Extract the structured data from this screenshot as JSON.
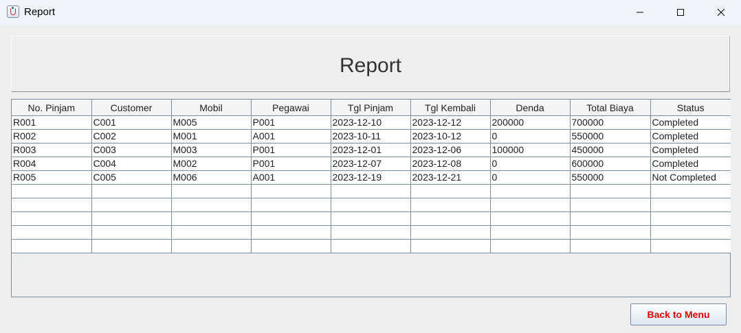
{
  "window": {
    "title": "Report"
  },
  "header": {
    "title": "Report"
  },
  "table": {
    "columns": [
      "No. Pinjam",
      "Customer",
      "Mobil",
      "Pegawai",
      "Tgl Pinjam",
      "Tgl Kembali",
      "Denda",
      "Total Biaya",
      "Status"
    ],
    "rows": [
      [
        "R001",
        "C001",
        "M005",
        "P001",
        "2023-12-10",
        "2023-12-12",
        "200000",
        "700000",
        "Completed"
      ],
      [
        "R002",
        "C002",
        "M001",
        "A001",
        "2023-10-11",
        "2023-10-12",
        "0",
        "550000",
        "Completed"
      ],
      [
        "R003",
        "C003",
        "M003",
        "P001",
        "2023-12-01",
        "2023-12-06",
        "100000",
        "450000",
        "Completed"
      ],
      [
        "R004",
        "C004",
        "M002",
        "P001",
        "2023-12-07",
        "2023-12-08",
        "0",
        "600000",
        "Completed"
      ],
      [
        "R005",
        "C005",
        "M006",
        "A001",
        "2023-12-19",
        "2023-12-21",
        "0",
        "550000",
        "Not Completed"
      ]
    ]
  },
  "buttons": {
    "back": "Back to Menu"
  },
  "icons": {
    "app": "java-cup-icon",
    "minimize": "minimize-icon",
    "maximize": "maximize-icon",
    "close": "close-icon"
  },
  "colors": {
    "back_button_text": "#e00000",
    "grid_border": "#7a8aa0"
  }
}
